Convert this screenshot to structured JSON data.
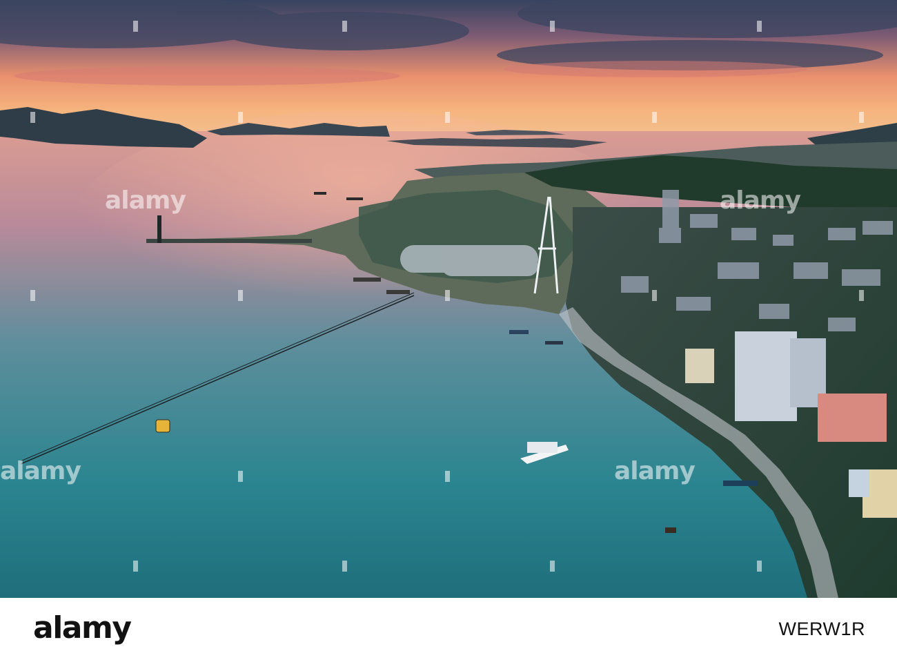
{
  "watermark": {
    "text": "alamy"
  },
  "footer": {
    "logo": "alamy",
    "image_id": "WERW1R"
  },
  "colors": {
    "sky_top": "#3a4a66",
    "sunset": "#f0a070",
    "water": "#2f8d95",
    "footer_bg": "#ffffff"
  }
}
